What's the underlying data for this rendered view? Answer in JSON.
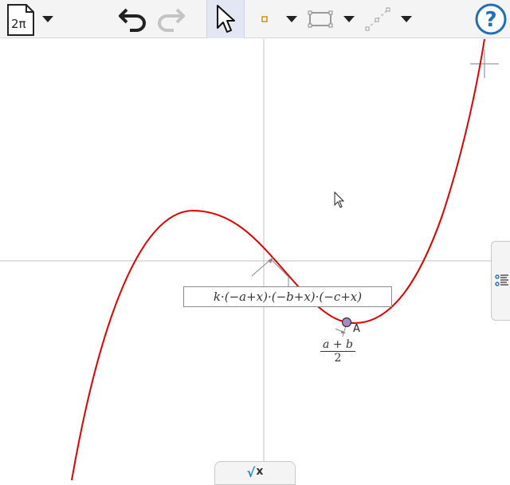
{
  "toolbar": {
    "perspective_label": "2π",
    "perspective_icon": "document-icon",
    "undo_icon": "undo-icon",
    "redo_icon": "redo-icon",
    "move_tool_icon": "pointer-arrow-icon",
    "point_tool_icon": "point-icon",
    "segment_tool_icon": "segment-icon",
    "line_tool_icon": "line-icon",
    "help_label": "?",
    "colors": {
      "help": "#1e6fb8",
      "point_tool": "#d88b00"
    }
  },
  "graphics": {
    "function_label": "k·(−a+x)·(−b+x)·(−c+x)",
    "point_label": "A",
    "fraction": {
      "numerator": "a + b",
      "denominator": "2"
    },
    "colors": {
      "curve": "#e00000",
      "axes": "#c0c0c0",
      "point_fill": "#a88ac3"
    }
  },
  "input_bar": {
    "label": "x",
    "icon": "sqrt-icon"
  },
  "side_panel": {
    "icon": "algebra-view-icon"
  }
}
